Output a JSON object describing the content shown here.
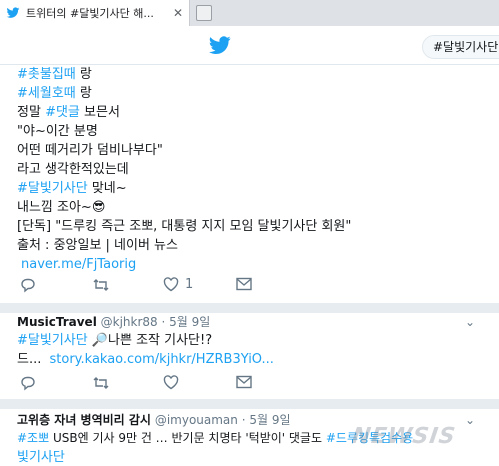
{
  "browser": {
    "tab_title": "트위터의 #달빛기사단 해...",
    "tab_close": "✕"
  },
  "header": {
    "search_value": "#달빛기사단"
  },
  "tweet1": {
    "lines": [
      {
        "parts": [
          {
            "text": "#촛불집때",
            "type": "tag"
          },
          {
            "text": " 랑",
            "type": "text"
          }
        ]
      },
      {
        "parts": [
          {
            "text": "#세월호때",
            "type": "tag"
          },
          {
            "text": " 랑",
            "type": "text"
          }
        ]
      },
      {
        "parts": [
          {
            "text": "정말 ",
            "type": "text"
          },
          {
            "text": "#댓글",
            "type": "tag"
          },
          {
            "text": " 보믄서",
            "type": "text"
          }
        ]
      },
      {
        "parts": [
          {
            "text": "\"야~이간 분명",
            "type": "text"
          }
        ]
      },
      {
        "parts": [
          {
            "text": "어떤 떼거리가 덤비나부다\"",
            "type": "text"
          }
        ]
      },
      {
        "parts": [
          {
            "text": "라고 생각한적있는데",
            "type": "text"
          }
        ]
      },
      {
        "parts": [
          {
            "text": "#달빛기사단",
            "type": "tag"
          },
          {
            "text": " 맞네~",
            "type": "text"
          }
        ]
      },
      {
        "parts": [
          {
            "text": "내느낌 조아~😎",
            "type": "text"
          }
        ]
      },
      {
        "parts": [
          {
            "text": "[단독] \"드루킹 즉근 조뽀, 대통령 지지 모임 달빛기사단 회원\"",
            "type": "text"
          }
        ]
      },
      {
        "parts": [
          {
            "text": "출처 : 중앙일보 | 네이버 뉴스",
            "type": "text"
          }
        ]
      },
      {
        "parts": [
          {
            "text": "naver.me/FjTaorig",
            "type": "link"
          }
        ]
      }
    ],
    "likes": "1"
  },
  "tweet2": {
    "name": "MusicTravel",
    "handle": "@kjhkr88",
    "time": "5월 9일",
    "line1_tag": "#달빛기사단",
    "line1_text": "🔎나쁜 조작 기사단!?",
    "line2_prefix": "드...",
    "line2_link": "story.kakao.com/kjhkr/HZRB3YiO..."
  },
  "tweet3": {
    "name": "고위층 자녀 병역비리 감시",
    "handle": "@imyouaman",
    "time": "5월 9일",
    "line1_tag": "#조뽀",
    "line1_text": " USB엔 기사 9만 건 … 반기문 치명타 '턱받이' 댓글도 ",
    "line1_tag2": "#드루킹특검수용",
    "line2_tag": "빛기사단"
  },
  "watermark": "NEWSIS",
  "colors": {
    "accent": "#1da1f2",
    "text": "#14171a",
    "muted": "#657786",
    "separator": "#e6ecf0"
  },
  "icons": [
    "twitter-favicon",
    "close-icon",
    "twitter-bird-icon",
    "reply-icon",
    "retweet-icon",
    "heart-icon",
    "dm-icon",
    "caret-down-icon"
  ]
}
